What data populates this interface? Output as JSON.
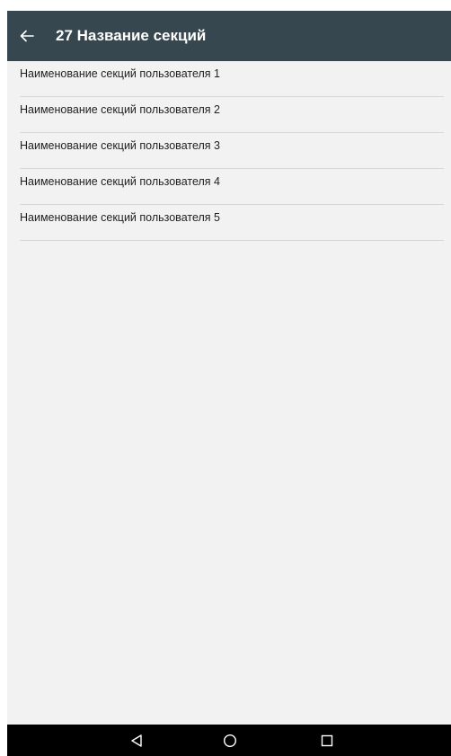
{
  "app_bar": {
    "back_icon": "arrow-left-icon",
    "title": "27 Название секций"
  },
  "list": {
    "items": [
      {
        "label": "Наименование секций пользователя 1"
      },
      {
        "label": "Наименование секций пользователя 2"
      },
      {
        "label": "Наименование секций пользователя 3"
      },
      {
        "label": "Наименование секций пользователя 4"
      },
      {
        "label": "Наименование секций пользователя 5"
      }
    ]
  },
  "nav_bar": {
    "back_icon": "nav-back-triangle-icon",
    "home_icon": "nav-home-circle-icon",
    "recents_icon": "nav-recents-square-icon"
  },
  "colors": {
    "app_bar": "#37474f",
    "background": "#f2f2f2",
    "divider": "#d6d6d6",
    "nav_bar": "#000000"
  }
}
